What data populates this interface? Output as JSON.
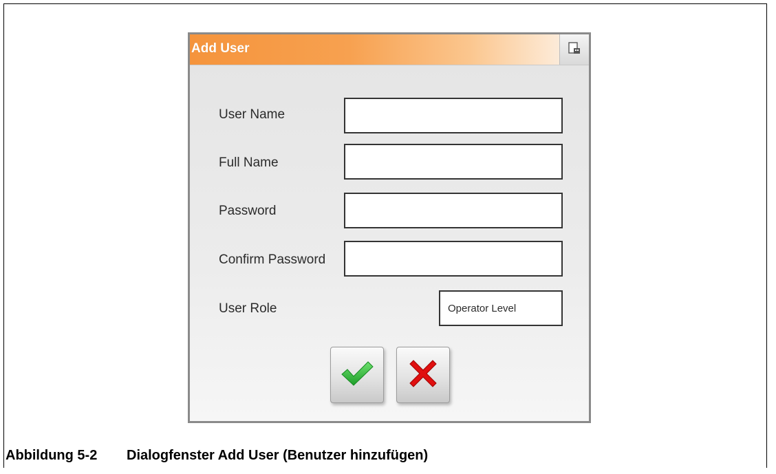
{
  "dialog": {
    "title": "Add User",
    "fields": [
      {
        "label": "User Name",
        "value": ""
      },
      {
        "label": "Full Name",
        "value": ""
      },
      {
        "label": "Password",
        "value": ""
      },
      {
        "label": "Confirm Password",
        "value": ""
      }
    ],
    "role_label": "User Role",
    "role_value": "Operator Level",
    "ok_icon": "checkmark-icon",
    "cancel_icon": "x-icon"
  },
  "caption": {
    "number": "Abbildung 5-2",
    "text": "Dialogfenster Add User (Benutzer hinzufügen)"
  },
  "colors": {
    "titlebar_accent": "#f5943c",
    "ok_green": "#3cc23c",
    "cancel_red": "#e01010"
  }
}
